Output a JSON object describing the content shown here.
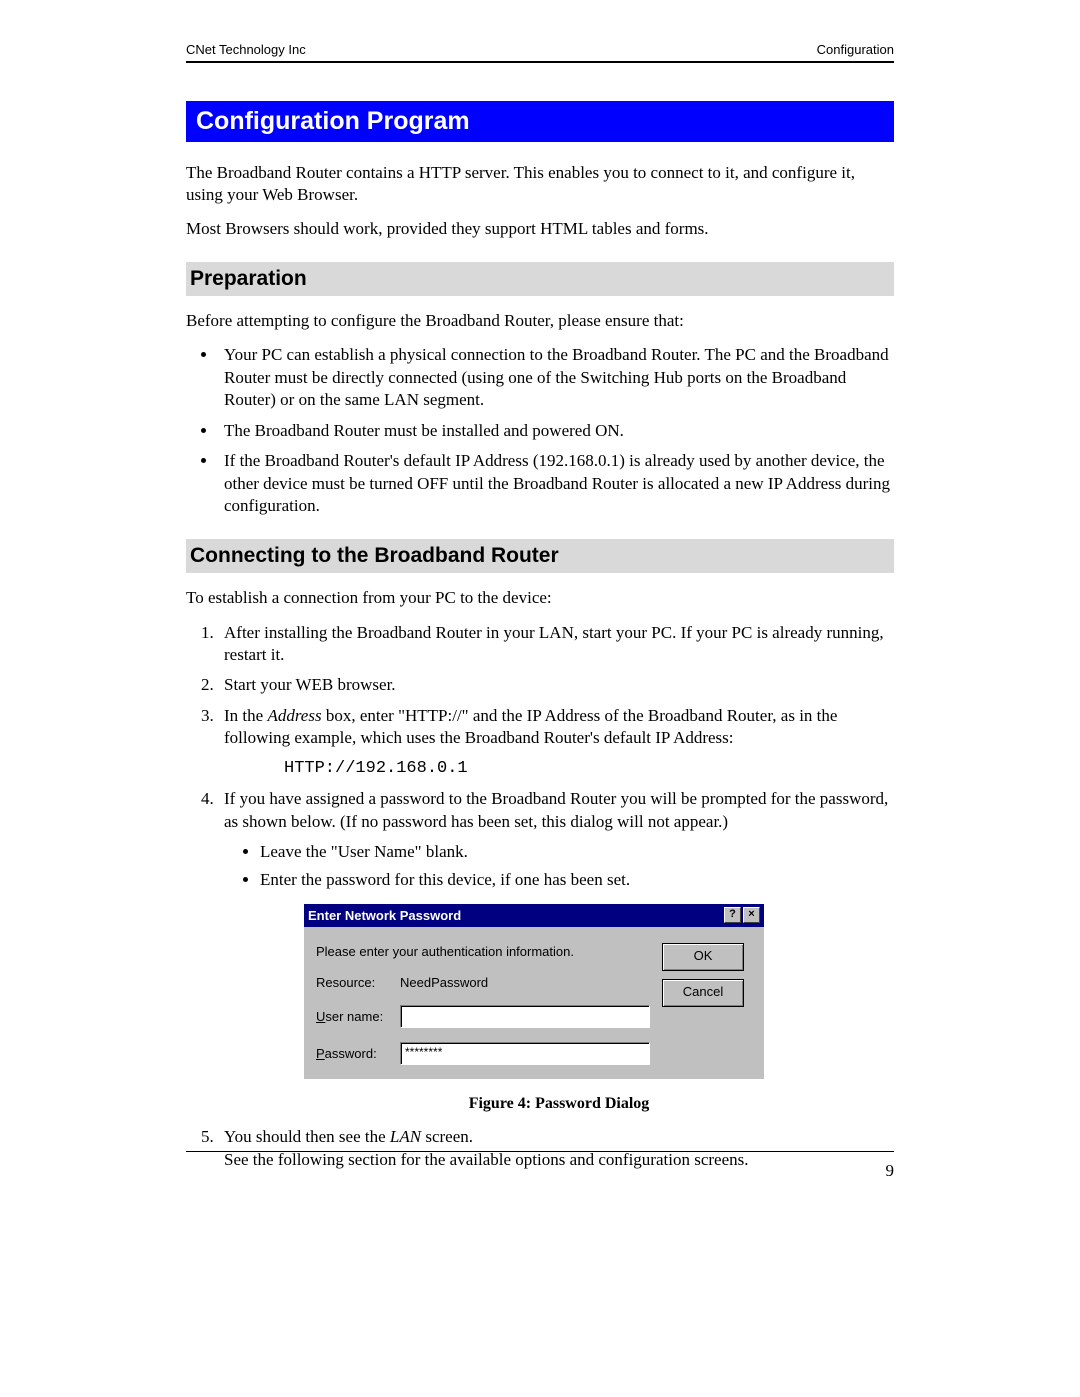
{
  "header": {
    "left": "CNet Technology Inc",
    "right": "Configuration"
  },
  "title_bar": "Configuration Program",
  "intro1": "The Broadband Router contains a HTTP server. This enables you to connect to it, and configure it, using your Web Browser.",
  "intro2": "Most Browsers should work, provided they support HTML tables and forms.",
  "prep": {
    "heading": "Preparation",
    "lead": "Before attempting to configure the Broadband Router, please ensure that:",
    "bullets": [
      "Your PC can establish a physical connection to the Broadband Router. The PC and the Broadband Router must be directly connected (using one of the Switching Hub ports on the Broadband Router) or on the same LAN segment.",
      "The Broadband Router must be installed and powered ON.",
      "If the Broadband Router's default IP Address (192.168.0.1) is already used by another device, the other device must be turned OFF until the Broadband Router is allocated a new IP Address during configuration."
    ]
  },
  "connect": {
    "heading": "Connecting to the Broadband Router",
    "lead": "To establish a connection from your PC to the device:",
    "steps": {
      "s1": "After installing the Broadband Router in your LAN, start your PC. If your PC is already running, restart it.",
      "s2": "Start your WEB browser.",
      "s3_pre": "In the ",
      "s3_italic": "Address",
      "s3_post": " box, enter \"HTTP://\" and the IP Address of the Broadband Router, as in the following example, which uses the Broadband Router's default IP Address:",
      "s3_code": "HTTP://192.168.0.1",
      "s4": "If you have assigned a password to the Broadband Router you will be prompted for the password, as shown below. (If no password has been set, this dialog will not appear.)",
      "s4_sub1": "Leave the \"User Name\" blank.",
      "s4_sub2": "Enter the password for this device, if one has been set.",
      "s5_pre": "You should then see the ",
      "s5_italic": "LAN",
      "s5_post": " screen.",
      "s5_line2": "See the following section for the available options and configuration screens."
    }
  },
  "dialog": {
    "title": "Enter Network Password",
    "help": "?",
    "close": "×",
    "instruction": "Please enter your authentication information.",
    "resource_label": "Resource:",
    "resource_value": "NeedPassword",
    "username_label": "User name:",
    "username_value": "",
    "password_label": "Password:",
    "password_value": "********",
    "ok": "OK",
    "cancel": "Cancel"
  },
  "figure_caption": "Figure 4: Password Dialog",
  "page_number": "9"
}
